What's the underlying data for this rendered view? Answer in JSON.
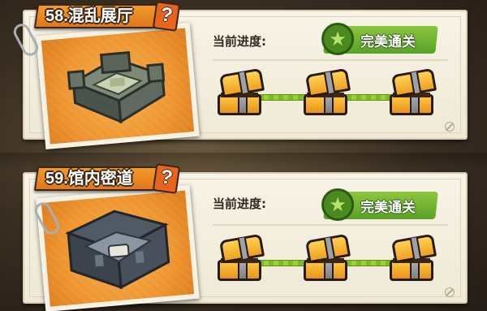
{
  "levels": [
    {
      "title": "58.混乱展厅",
      "help_icon": "?",
      "progress_label": "当前进度:",
      "badge_text": "完美通关",
      "badge_icon": "star-icon",
      "chests": [
        "chest-icon",
        "chest-icon",
        "chest-icon"
      ],
      "accent_color": "#e0781a",
      "badge_color": "#5aa126"
    },
    {
      "title": "59.馆内密道",
      "help_icon": "?",
      "progress_label": "当前进度:",
      "badge_text": "完美通关",
      "badge_icon": "star-icon",
      "chests": [
        "chest-icon",
        "chest-icon",
        "chest-icon"
      ],
      "accent_color": "#e0781a",
      "badge_color": "#5aa126"
    }
  ]
}
